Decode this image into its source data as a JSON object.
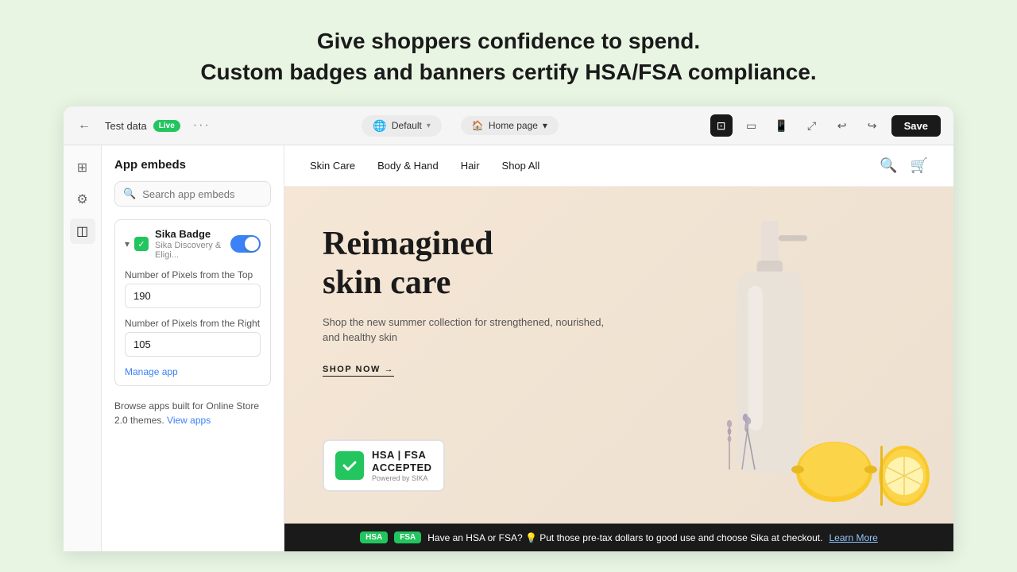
{
  "header": {
    "line1": "Give shoppers confidence to spend.",
    "line2": "Custom badges and banners certify HSA/FSA compliance."
  },
  "browser": {
    "tab_label": "Test data",
    "live_status": "Live",
    "more_options": "···",
    "default_label": "Default",
    "default_chevron": "▾",
    "home_page_label": "Home page",
    "home_page_chevron": "▾",
    "save_label": "Save",
    "undo_label": "↩",
    "redo_label": "↪"
  },
  "sidebar": {
    "icons": [
      "⊞",
      "⚙",
      "◫"
    ]
  },
  "panel": {
    "title": "App embeds",
    "search_placeholder": "Search app embeds",
    "embed_name": "Sika Badge",
    "embed_sub": "Sika Discovery & Eligi...",
    "field1_label": "Number of Pixels from the Top",
    "field1_value": "190",
    "field2_label": "Number of Pixels from the Right",
    "field2_value": "105",
    "manage_link": "Manage app",
    "browse_text": "Browse apps built for Online Store 2.0 themes.",
    "view_apps_link": "View apps"
  },
  "store": {
    "nav_links": [
      "Skin Care",
      "Body & Hand",
      "Hair",
      "Shop All"
    ],
    "hero_title_line1": "Reimagined",
    "hero_title_line2": "skin care",
    "hero_desc": "Shop the new summer collection for strengthened, nourished, and healthy skin",
    "hero_cta": "SHOP NOW →",
    "hsa_badge_title": "HSA | FSA",
    "hsa_badge_line2": "ACCEPTED",
    "hsa_badge_powered": "Powered by SIKA",
    "banner_text": "Have an HSA or FSA? 💡 Put those pre-tax dollars to good use and choose Sika at checkout.",
    "banner_link": "Learn More",
    "hsa_tag": "HSA",
    "fsa_tag": "FSA"
  }
}
